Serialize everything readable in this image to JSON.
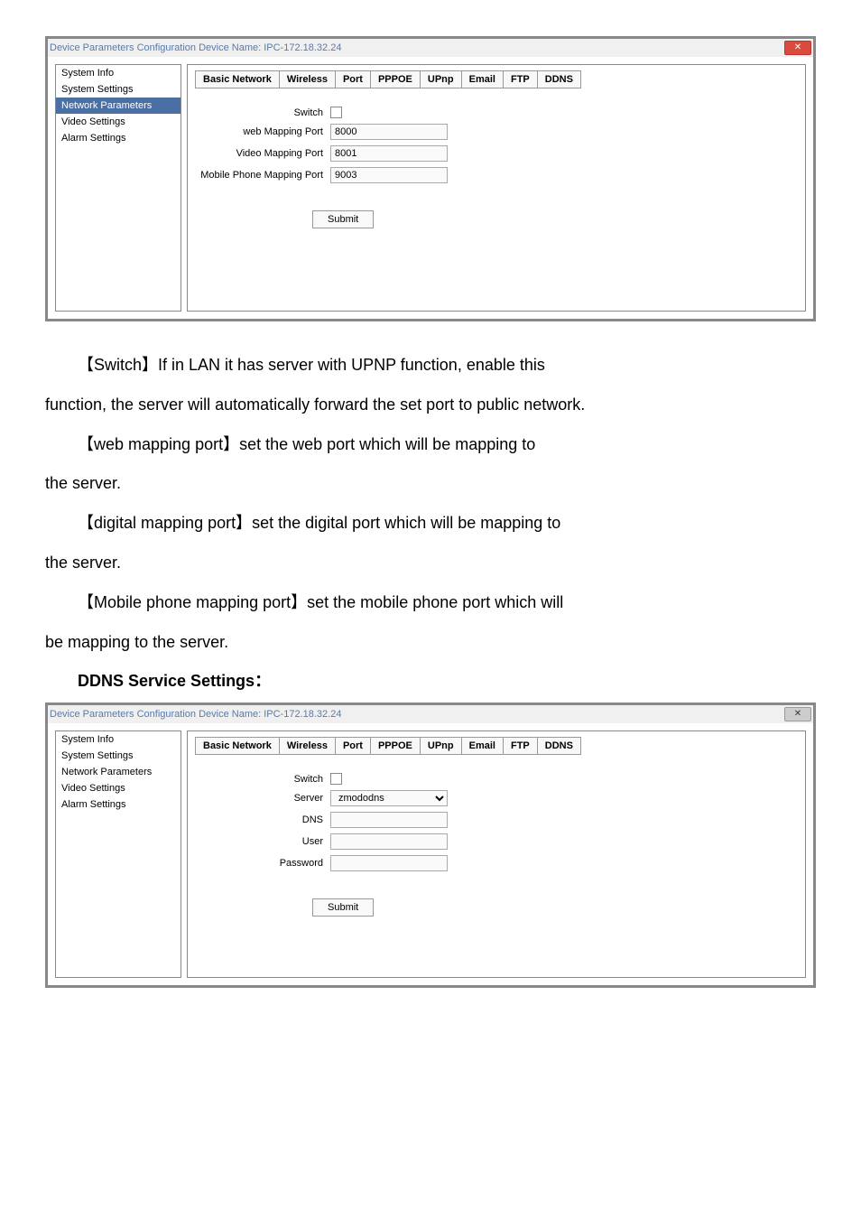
{
  "dialog1": {
    "title": "Device Parameters Configuration   Device Name: IPC-172.18.32.24",
    "sidebar": [
      "System Info",
      "System Settings",
      "Network Parameters",
      "Video Settings",
      "Alarm Settings"
    ],
    "activeIndex": 2,
    "tabs": [
      "Basic Network",
      "Wireless",
      "Port",
      "PPPOE",
      "UPnp",
      "Email",
      "FTP",
      "DDNS"
    ],
    "activeTab": 4,
    "fields": {
      "switch_label": "Switch",
      "web_label": "web Mapping Port",
      "web_value": "8000",
      "video_label": "Video Mapping Port",
      "video_value": "8001",
      "mobile_label": "Mobile Phone Mapping Port",
      "mobile_value": "9003"
    },
    "submit": "Submit"
  },
  "dialog2": {
    "title": "Device Parameters Configuration   Device Name: IPC-172.18.32.24",
    "sidebar": [
      "System Info",
      "System Settings",
      "Network Parameters",
      "Video Settings",
      "Alarm Settings"
    ],
    "activeIndex": -1,
    "tabs": [
      "Basic Network",
      "Wireless",
      "Port",
      "PPPOE",
      "UPnp",
      "Email",
      "FTP",
      "DDNS"
    ],
    "activeTab": 7,
    "fields": {
      "switch_label": "Switch",
      "server_label": "Server",
      "server_value": "zmododns",
      "dns_label": "DNS",
      "user_label": "User",
      "password_label": "Password"
    },
    "submit": "Submit"
  },
  "para": {
    "p1a": "【Switch】If in LAN it has server with UPNP   function, enable this",
    "p1b": "function, the server will automatically forward the set port to public network.",
    "p2a": "【web mapping port】set the web port which will be mapping to",
    "p2b": "the server.",
    "p3a": "【digital mapping port】set the digital port which will be mapping to",
    "p3b": "the server.",
    "p4a": "【Mobile phone mapping port】set the mobile phone port which will",
    "p4b": "be mapping to the server.",
    "heading": "DDNS Service Settings："
  }
}
